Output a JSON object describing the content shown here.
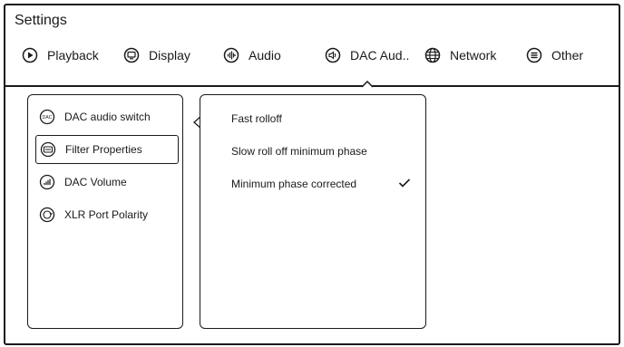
{
  "window": {
    "title": "Settings"
  },
  "tabs": [
    {
      "label": "Playback",
      "icon": "play-circle-icon"
    },
    {
      "label": "Display",
      "icon": "monitor-icon"
    },
    {
      "label": "Audio",
      "icon": "audio-wave-icon"
    },
    {
      "label": "DAC Aud..",
      "icon": "speaker-icon",
      "active": true
    },
    {
      "label": "Network",
      "icon": "globe-icon"
    },
    {
      "label": "Other",
      "icon": "menu-circle-icon"
    }
  ],
  "submenu": [
    {
      "label": "DAC audio switch",
      "icon": "dac-icon"
    },
    {
      "label": "Filter Properties",
      "icon": "filter-icon",
      "selected": true
    },
    {
      "label": "DAC Volume",
      "icon": "volume-icon"
    },
    {
      "label": "XLR Port Polarity",
      "icon": "polarity-icon"
    }
  ],
  "options": [
    {
      "label": "Fast rolloff",
      "checked": false
    },
    {
      "label": "Slow roll off minimum phase",
      "checked": false
    },
    {
      "label": "Minimum phase corrected",
      "checked": true
    }
  ],
  "colors": {
    "foreground": "#1a1a1a",
    "background": "#ffffff"
  }
}
